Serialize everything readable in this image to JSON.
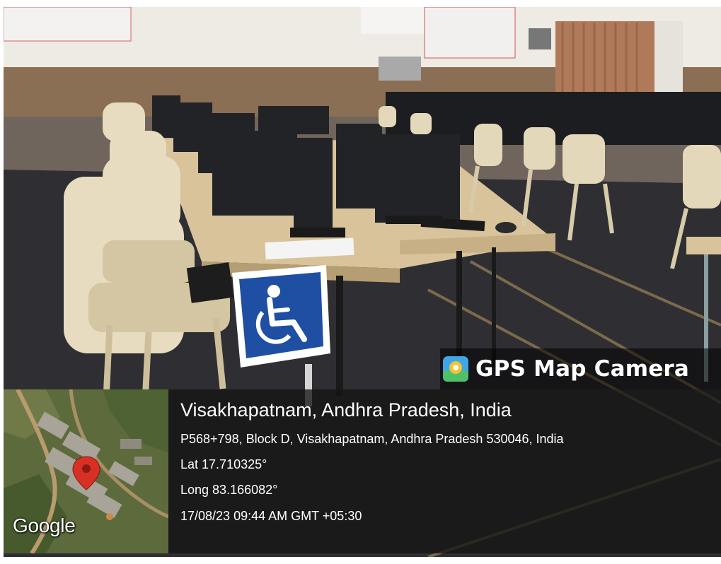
{
  "watermark": {
    "app_name": "GPS Map Camera",
    "icon": "gps-map-camera-app-icon"
  },
  "map": {
    "attribution": "Google",
    "marker": "location-pin-icon"
  },
  "location": {
    "title": "Visakhapatnam, Andhra Pradesh, India",
    "address": "P568+798, Block D, Visakhapatnam, Andhra Pradesh 530046, India",
    "latitude": "Lat 17.710325°",
    "longitude": "Long 83.166082°",
    "timestamp": "17/08/23 09:44 AM GMT +05:30"
  },
  "sign": {
    "icon": "wheelchair-accessibility-icon"
  },
  "colors": {
    "sign_blue": "#1f4fa3",
    "pin_red": "#d93025",
    "panel_bg": "#141414"
  }
}
